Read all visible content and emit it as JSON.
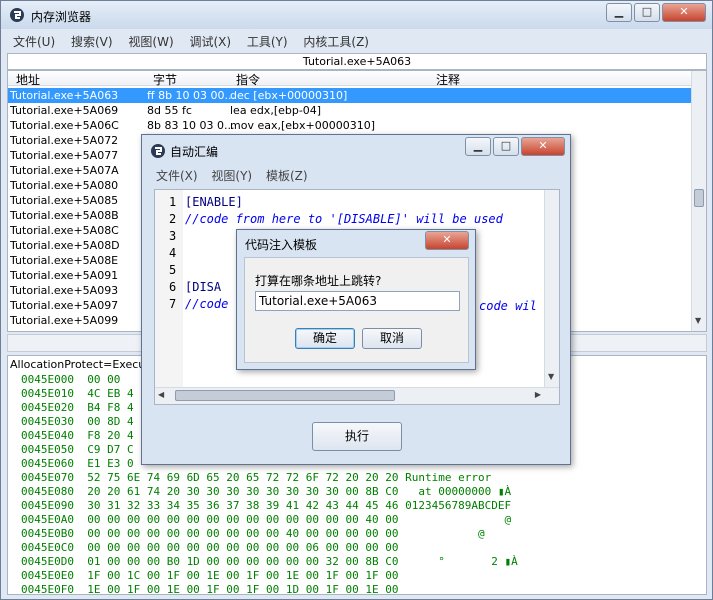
{
  "main_window": {
    "title": "内存浏览器",
    "controls": {
      "minimize": "▁",
      "maximize": "□",
      "close": "✕"
    },
    "menu": [
      "文件(U)",
      "搜索(V)",
      "视图(W)",
      "调试(X)",
      "工具(Y)",
      "内核工具(Z)"
    ],
    "address_bar": "Tutorial.exe+5A063",
    "columns": [
      "地址",
      "字节",
      "指令",
      "注释"
    ],
    "rows": [
      {
        "addr": "Tutorial.exe+5A063",
        "bytes": "ff 8b 10 03 00...",
        "instr": "dec [ebx+00000310]"
      },
      {
        "addr": "Tutorial.exe+5A069",
        "bytes": "8d 55 fc",
        "instr": "lea edx,[ebp-04]"
      },
      {
        "addr": "Tutorial.exe+5A06C",
        "bytes": "8b 83 10 03 0...",
        "instr": "mov eax,[ebx+00000310]"
      },
      {
        "addr": "Tutorial.exe+5A072",
        "bytes": "",
        "instr": ""
      },
      {
        "addr": "Tutorial.exe+5A077",
        "bytes": "",
        "instr": ""
      },
      {
        "addr": "Tutorial.exe+5A07A",
        "bytes": "",
        "instr": ""
      },
      {
        "addr": "Tutorial.exe+5A080",
        "bytes": "",
        "instr": ""
      },
      {
        "addr": "Tutorial.exe+5A085",
        "bytes": "",
        "instr": ""
      },
      {
        "addr": "Tutorial.exe+5A08B",
        "bytes": "",
        "instr": ""
      },
      {
        "addr": "Tutorial.exe+5A08C",
        "bytes": "",
        "instr": ""
      },
      {
        "addr": "Tutorial.exe+5A08D",
        "bytes": "",
        "instr": ""
      },
      {
        "addr": "Tutorial.exe+5A08E",
        "bytes": "",
        "instr": ""
      },
      {
        "addr": "Tutorial.exe+5A091",
        "bytes": "",
        "instr": ""
      },
      {
        "addr": "Tutorial.exe+5A093",
        "bytes": "",
        "instr": ""
      },
      {
        "addr": "Tutorial.exe+5A097",
        "bytes": "",
        "instr": ""
      },
      {
        "addr": "Tutorial.exe+5A099",
        "bytes": "",
        "instr": ""
      }
    ],
    "hex_protect": "AllocationProtect=Execute/",
    "hex_rows": [
      "0045E000  00 00",
      "0045E010  4C EB 4",
      "0045E020  B4 F8 4",
      "0045E030  00 8D 4",
      "0045E040  F8 20 4",
      "0045E050  C9 D7 C",
      "0045E060  E1 E3 0",
      "0045E070  52 75 6E 74 69 6D 65 20 65 72 72 6F 72 20 20 20 Runtime error",
      "0045E080  20 20 61 74 20 30 30 30 30 30 30 30 30 00 8B C0   at 00000000 ▮À",
      "0045E090  30 31 32 33 34 35 36 37 38 39 41 42 43 44 45 46 0123456789ABCDEF",
      "0045E0A0  00 00 00 00 00 00 00 00 00 00 00 00 00 00 40 00                @",
      "0045E0B0  00 00 00 00 00 00 00 00 00 00 40 00 00 00 00 00            @",
      "0045E0C0  00 00 00 00 00 00 00 00 00 00 00 06 00 00 00 00",
      "0045E0D0  01 00 00 00 B0 1D 00 00 00 00 00 00 32 00 8B C0      °       2 ▮À",
      "0045E0E0  1F 00 1C 00 1F 00 1E 00 1F 00 1E 00 1F 00 1F 00",
      "0045E0F0  1E 00 1F 00 1E 00 1F 00 1F 00 1D 00 1F 00 1E 00",
      "0045E100  1F 00 1E 00 1F 00 1F 00 1E 00 1F 00 1E 00 1F 00"
    ]
  },
  "auto_assemble": {
    "title": "自动汇编",
    "controls": {
      "minimize": "▁",
      "maximize": "□",
      "close": "✕"
    },
    "menu": [
      "文件(X)",
      "视图(Y)",
      "模板(Z)"
    ],
    "lines": [
      {
        "n": "1",
        "text": "[ENABLE]",
        "comment": false
      },
      {
        "n": "2",
        "text": "//code from here to '[DISABLE]' will be used",
        "comment": true
      },
      {
        "n": "3",
        "text": "",
        "comment": false
      },
      {
        "n": "4",
        "text": "",
        "comment": false
      },
      {
        "n": "5",
        "text": "",
        "comment": false
      },
      {
        "n": "6",
        "text": "[DISA",
        "comment": false
      },
      {
        "n": "7",
        "text": "//code",
        "comment": true
      }
    ],
    "line7_tail": "code wil",
    "execute_label": "执行"
  },
  "template_dialog": {
    "title": "代码注入模板",
    "close": "✕",
    "prompt": "打算在哪条地址上跳转?",
    "input_value": "Tutorial.exe+5A063",
    "ok_label": "确定",
    "cancel_label": "取消"
  }
}
